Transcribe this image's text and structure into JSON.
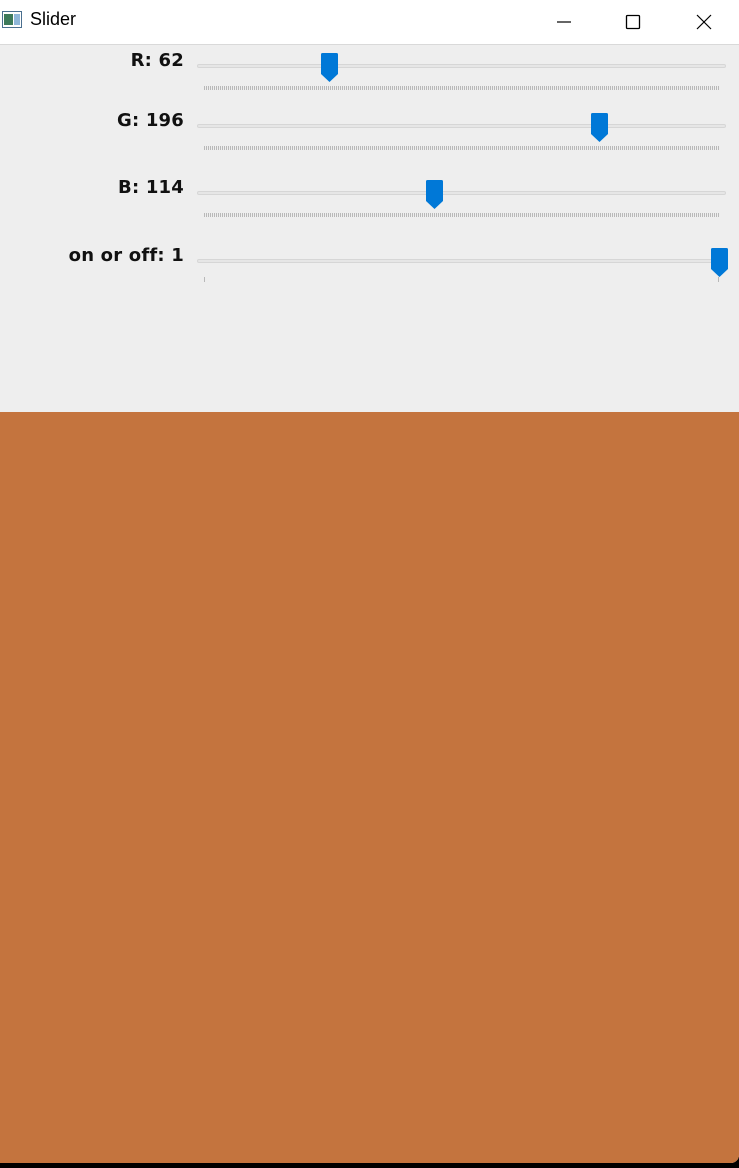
{
  "window": {
    "title": "Slider"
  },
  "sliders": [
    {
      "label": "R: 62",
      "name": "R",
      "value": 62,
      "max": 255
    },
    {
      "label": "G: 196",
      "name": "G",
      "value": 196,
      "max": 255
    },
    {
      "label": "B: 114",
      "name": "B",
      "value": 114,
      "max": 255
    },
    {
      "label": "on or off: 1",
      "name": "on or off",
      "value": 1,
      "max": 1
    }
  ],
  "colors": {
    "preview": "#c4743e",
    "thumb": "#0078d7",
    "panel": "#eeeeee"
  },
  "icons": {
    "app": "app-icon",
    "minimize": "minimize-icon",
    "maximize": "maximize-icon",
    "close": "close-icon"
  }
}
